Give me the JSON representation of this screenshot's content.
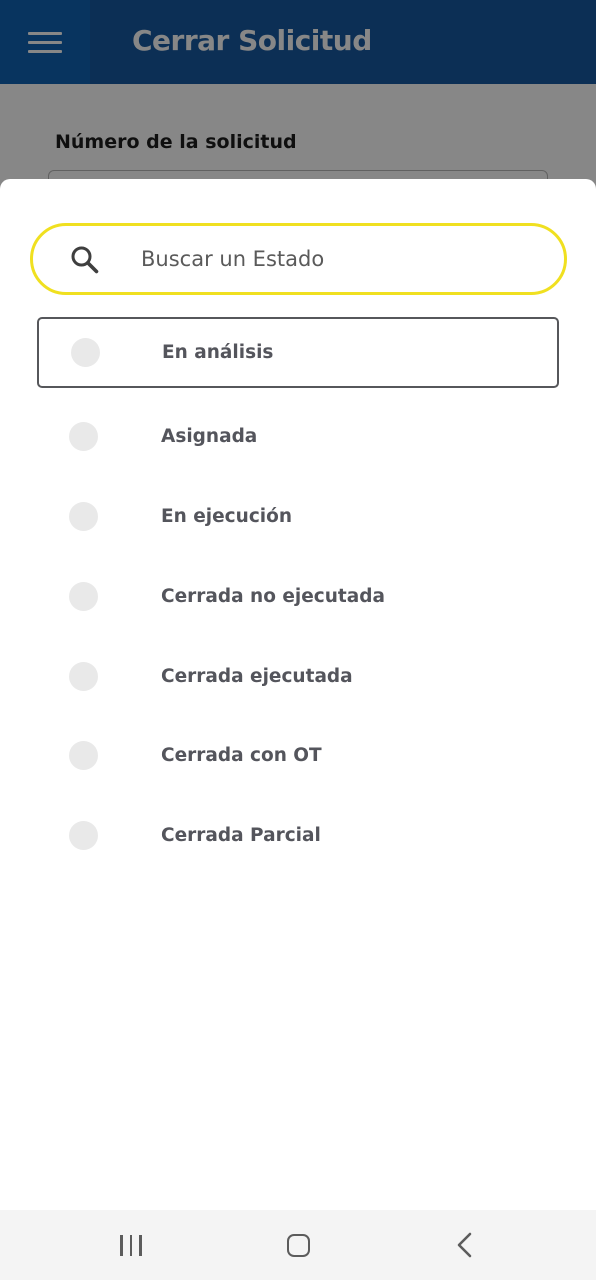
{
  "app_bar": {
    "title": "Cerrar Solicitud",
    "menu_icon": "hamburger-menu-icon",
    "color": "#175aa0",
    "menu_color": "#1063b3"
  },
  "background_form": {
    "field_label": "Número de la solicitud"
  },
  "sheet": {
    "search": {
      "placeholder": "Buscar un Estado",
      "value": "",
      "icon": "search-icon",
      "border_color": "#f0e020"
    },
    "options": [
      {
        "label": "En análisis",
        "selected": true
      },
      {
        "label": "Asignada",
        "selected": false
      },
      {
        "label": "En ejecución",
        "selected": false
      },
      {
        "label": "Cerrada no ejecutada",
        "selected": false
      },
      {
        "label": "Cerrada ejecutada",
        "selected": false
      },
      {
        "label": "Cerrada con OT",
        "selected": false
      },
      {
        "label": "Cerrada Parcial",
        "selected": false
      }
    ]
  },
  "system_nav": {
    "recents_icon": "recents-icon",
    "home_icon": "home-icon",
    "back_icon": "back-icon"
  }
}
